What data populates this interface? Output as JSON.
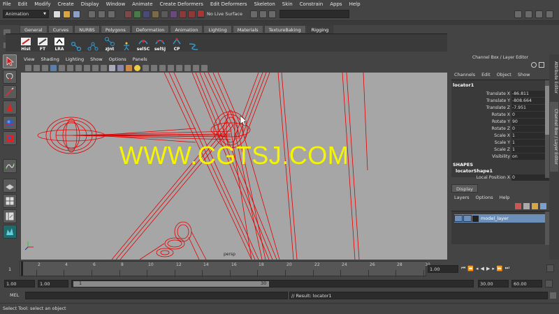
{
  "menubar": {
    "items": [
      "File",
      "Edit",
      "Modify",
      "Create",
      "Display",
      "Window",
      "Animate",
      "Create Deformers",
      "Edit Deformers",
      "Skeleton",
      "Skin",
      "Constrain",
      "Apps",
      "Help"
    ]
  },
  "statusline": {
    "mode_value": "Animation",
    "live_surface_label": "No Live Surface"
  },
  "shelf": {
    "tabs": [
      "General",
      "Curves",
      "NURBS",
      "Polygons",
      "Deformation",
      "Animation",
      "Lighting",
      "Materials",
      "TextureBaking",
      "Rigging"
    ],
    "active_tab": "Rigging",
    "buttons": [
      "Hist",
      "FT",
      "LRA",
      "",
      "",
      "zJnt",
      "",
      "selSC",
      "selSJ",
      "CP",
      ""
    ]
  },
  "viewport": {
    "menu": [
      "View",
      "Shading",
      "Lighting",
      "Show",
      "Options",
      "Panels"
    ],
    "camera_label": "persp",
    "watermark": "WWW.CGTSJ.COM"
  },
  "channel_box": {
    "title": "Channel Box / Layer Editor",
    "menu": [
      "Channels",
      "Edit",
      "Object",
      "Show"
    ],
    "object_name": "locator1",
    "attributes": [
      {
        "name": "Translate X",
        "value": "-86.811"
      },
      {
        "name": "Translate Y",
        "value": "-808.664"
      },
      {
        "name": "Translate Z",
        "value": "-7.951"
      },
      {
        "name": "Rotate X",
        "value": "0"
      },
      {
        "name": "Rotate Y",
        "value": "90"
      },
      {
        "name": "Rotate Z",
        "value": "0"
      },
      {
        "name": "Scale X",
        "value": "1"
      },
      {
        "name": "Scale Y",
        "value": "1"
      },
      {
        "name": "Scale Z",
        "value": "1"
      },
      {
        "name": "Visibility",
        "value": "on"
      }
    ],
    "shapes_label": "SHAPES",
    "shape_name": "locatorShape1",
    "shape_attr": {
      "name": "Local Position X",
      "value": "0"
    }
  },
  "layer_editor": {
    "tab": "Display",
    "menu": [
      "Layers",
      "Options",
      "Help"
    ],
    "layer_name": "model_layer"
  },
  "side_tabs": [
    "Attribute Editor",
    "Channel Box / Layer Editor"
  ],
  "timeline": {
    "ticks": [
      "2",
      "4",
      "6",
      "8",
      "10",
      "12",
      "14",
      "16",
      "18",
      "20",
      "22",
      "24",
      "26",
      "28",
      "30"
    ],
    "start_frame": "1",
    "current_frame": "1.00"
  },
  "range": {
    "start": "1.00",
    "playback_start": "1.00",
    "slider_start": "1",
    "slider_end": "30",
    "playback_end": "30.00",
    "end": "60.00"
  },
  "command": {
    "label": "MEL",
    "result": "// Result: locator1"
  },
  "help_line": "Select Tool: select an object",
  "colors": {
    "wire": "#e00000",
    "viewport_bg": "#a6a6a6",
    "watermark": "#f5f500",
    "layer_highlight": "#6b8fb8"
  }
}
